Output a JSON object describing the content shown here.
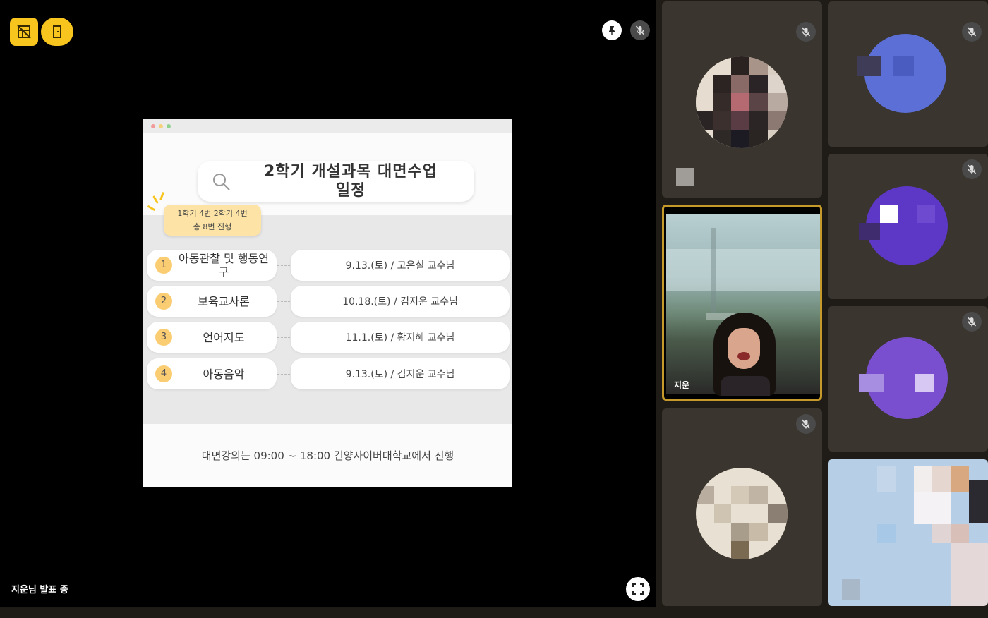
{
  "main": {
    "presenter_status": "지운님 발표 중",
    "icons": {
      "toolbar_left": "layout-off-icon",
      "toolbar_exit": "exit-door-icon",
      "pin": "pin-icon",
      "mic": "mic-off-icon",
      "fullscreen": "fullscreen-icon"
    },
    "accent_color": "#f7c51e"
  },
  "slide": {
    "title_line1": "2학기 개설과목 대면수업",
    "title_line2": "일정",
    "sticky_line1": "1학기 4번 2학기 4번",
    "sticky_line2": "총 8번 진행",
    "rows": [
      {
        "num": "1",
        "name": "아동관찰 및 행동연구",
        "schedule": "9.13.(토) / 고은실 교수님"
      },
      {
        "num": "2",
        "name": "보육교사론",
        "schedule": "10.18.(토) / 김지운 교수님"
      },
      {
        "num": "3",
        "name": "언어지도",
        "schedule": "11.1.(토) / 황지혜 교수님"
      },
      {
        "num": "4",
        "name": "아동음악",
        "schedule": "9.13.(토) / 김지운 교수님"
      }
    ],
    "footer": "대면강의는 09:00 ~ 18:00 건양사이버대학교에서 진행"
  },
  "participants": {
    "active_speaker_name": "지운",
    "active_border_color": "#c69a2a"
  }
}
